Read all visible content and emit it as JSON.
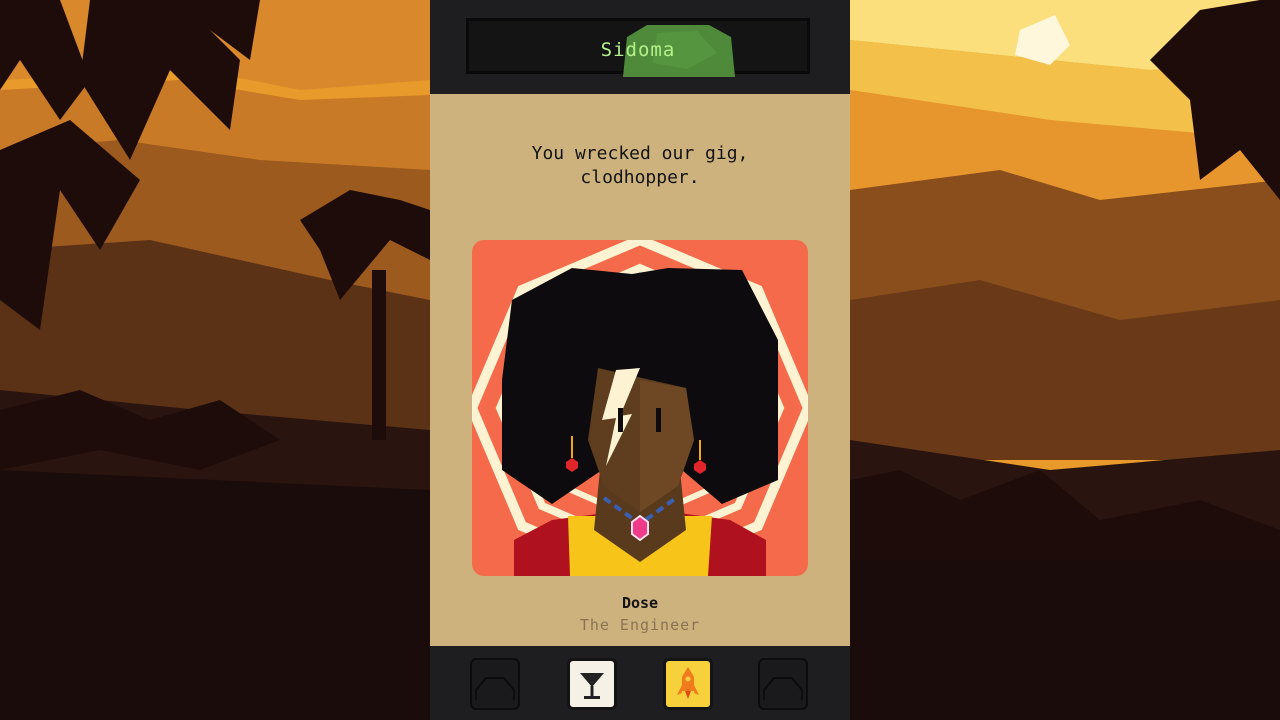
{
  "header": {
    "location_name": "Sidoma"
  },
  "dialogue": {
    "text": "You wrecked our gig,\nclodhopper."
  },
  "character": {
    "name": "Dose",
    "role": "The Engineer"
  },
  "inventory": {
    "slots": [
      {
        "state": "empty"
      },
      {
        "state": "item",
        "icon": "cocktail-glass-icon",
        "color": "#f5f1e6"
      },
      {
        "state": "item",
        "icon": "rocket-icon",
        "color": "#f6d13b"
      },
      {
        "state": "empty"
      }
    ]
  },
  "colors": {
    "panel_dark": "#1e1e20",
    "card_tan": "#cdb27e",
    "portrait_bg": "#f46a4a",
    "title_green": "#b4f08a"
  }
}
